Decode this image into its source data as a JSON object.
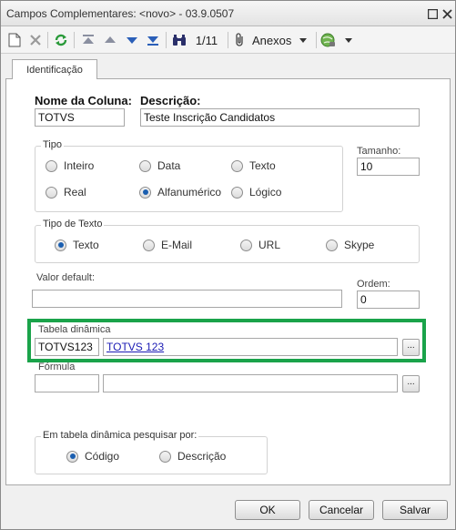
{
  "window": {
    "title": "Campos Complementares: <novo> - 03.9.0507"
  },
  "toolbar": {
    "record_counter": "1/11",
    "attachments_label": "Anexos"
  },
  "tabs": [
    {
      "label": "Identificação"
    }
  ],
  "form": {
    "nome_label": "Nome da Coluna:",
    "nome_value": "TOTVS",
    "descricao_label": "Descrição:",
    "descricao_value": "Teste Inscrição Candidatos",
    "tipo": {
      "title": "Tipo",
      "options": [
        "Inteiro",
        "Data",
        "Texto",
        "Real",
        "Alfanumérico",
        "Lógico"
      ],
      "selected": "Alfanumérico"
    },
    "tamanho_label": "Tamanho:",
    "tamanho_value": "10",
    "tipo_texto": {
      "title": "Tipo de Texto",
      "options": [
        "Texto",
        "E-Mail",
        "URL",
        "Skype"
      ],
      "selected": "Texto"
    },
    "valor_default_label": "Valor default:",
    "valor_default_value": "",
    "ordem_label": "Ordem:",
    "ordem_value": "0",
    "tabela_dinamica_label": "Tabela dinâmica",
    "tabela_dinamica_code": "TOTVS123",
    "tabela_dinamica_desc": "TOTVS 123",
    "formula_label": "Fórmula",
    "formula_code": "",
    "formula_desc": "",
    "ellipsis_label": "...",
    "pesquisar": {
      "title": "Em tabela dinâmica pesquisar por:",
      "options": [
        "Código",
        "Descrição"
      ],
      "selected": "Código"
    }
  },
  "buttons": {
    "ok": "OK",
    "cancel": "Cancelar",
    "save": "Salvar"
  },
  "colors": {
    "highlight": "#1aa34a",
    "link": "#1a1ab4",
    "radio_selected": "#1b5fb0"
  }
}
